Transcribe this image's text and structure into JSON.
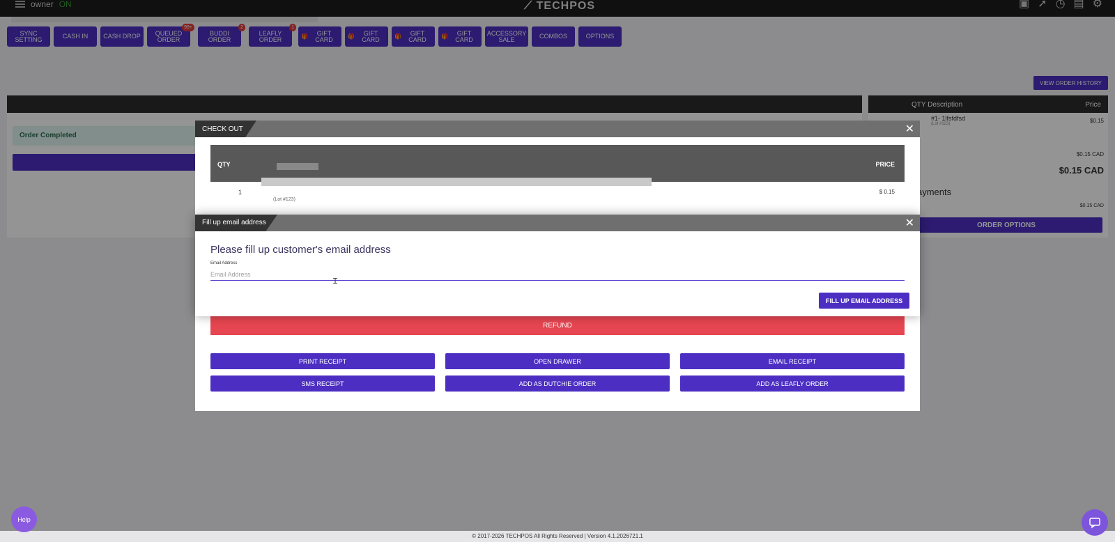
{
  "topbar": {
    "user": "owner",
    "status": "ON",
    "logo": "TECHPOS",
    "icons": [
      "video-icon",
      "rocket-icon",
      "clock-icon",
      "calendar-icon",
      "gear-icon"
    ]
  },
  "toolbar": [
    {
      "label": "SYNC SETTING"
    },
    {
      "label": "CASH IN"
    },
    {
      "label": "CASH DROP"
    },
    {
      "label": "QUEUED ORDER",
      "badge": "99+"
    },
    {
      "label": "BUDDI ORDER",
      "badge": "2"
    },
    {
      "label": "LEAFLY ORDER",
      "badge": "1"
    },
    {
      "label": "GIFT CARD",
      "gift": true
    },
    {
      "label": "GIFT CARD",
      "gift": true
    },
    {
      "label": "GIFT CARD",
      "gift": true
    },
    {
      "label": "GIFT CARD",
      "gift": true
    },
    {
      "label": "ACCESSORY SALE"
    },
    {
      "label": "COMBOS"
    },
    {
      "label": "OPTIONS"
    }
  ],
  "view_order_history": "VIEW ORDER HISTORY",
  "left_panel": {
    "order_completed": "Order Completed"
  },
  "cart": {
    "qty_desc": "QTY Description",
    "price": "Price",
    "item_name": "#1- 1lfsfdfsd",
    "item_lot": "(Lot #123)",
    "item_price": "$0.15",
    "subtotal": "$0.15 CAD",
    "total": "$0.15 CAD",
    "payments": "ayments",
    "payments_amount": "$0.15 CAD",
    "order_options": "ORDER OPTIONS"
  },
  "checkout": {
    "title": "CHECK OUT",
    "qty_header": "QTY",
    "price_header": "PRICE",
    "row_qty": "1",
    "row_lot": "(Lot #123)",
    "row_price": "$ 0.15",
    "refund": "REFUND",
    "actions": [
      "PRINT RECEIPT",
      "OPEN DRAWER",
      "EMAIL RECEIPT",
      "SMS RECEIPT",
      "ADD AS DUTCHIE ORDER",
      "ADD AS LEAFLY ORDER"
    ]
  },
  "email_modal": {
    "title": "Fill up email address",
    "heading": "Please fill up customer's email address",
    "field_label": "Email Address",
    "placeholder": "Email Address",
    "value": "",
    "submit": "FILL UP EMAIL ADDRESS"
  },
  "footer": "© 2017-2026 TECHPOS All Rights Reserved | Version 4.1.2026721.1",
  "help": "Help"
}
